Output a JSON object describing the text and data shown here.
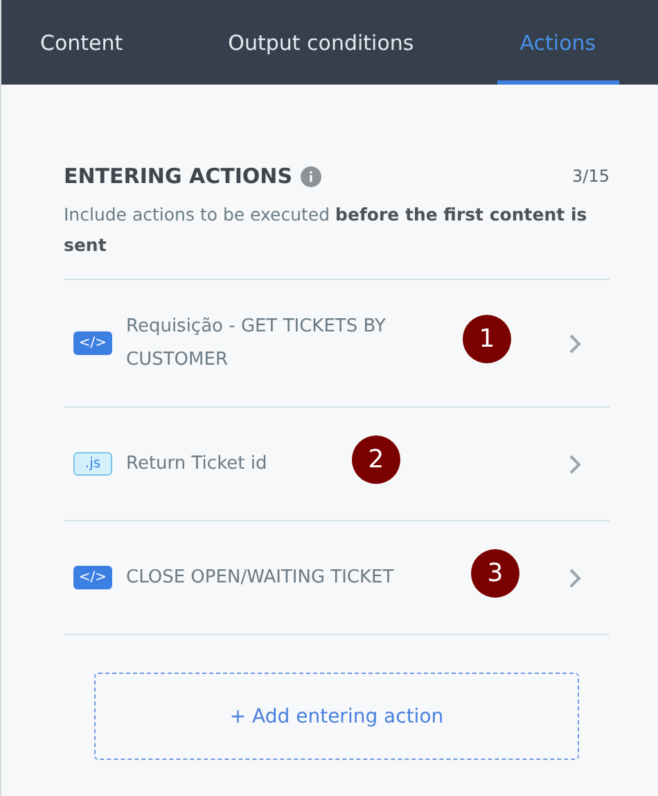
{
  "tabs": [
    {
      "label": "Content",
      "selected": false
    },
    {
      "label": "Output conditions",
      "selected": false
    },
    {
      "label": "Actions",
      "selected": true
    }
  ],
  "section": {
    "title": "ENTERING ACTIONS",
    "count": "3/15",
    "description": "Include actions to be executed **before the first content is sent**"
  },
  "actions": [
    {
      "kind": "code",
      "badge": "</>",
      "label": "Requisição - GET TICKETS BY CUSTOMER",
      "marker": "1"
    },
    {
      "kind": "script",
      "badge": ".js",
      "label": "Return Ticket id",
      "marker": "2"
    },
    {
      "kind": "code",
      "badge": "</>",
      "label": "CLOSE OPEN/WAITING TICKET",
      "marker": "3"
    }
  ],
  "add_button": "+ Add entering action"
}
